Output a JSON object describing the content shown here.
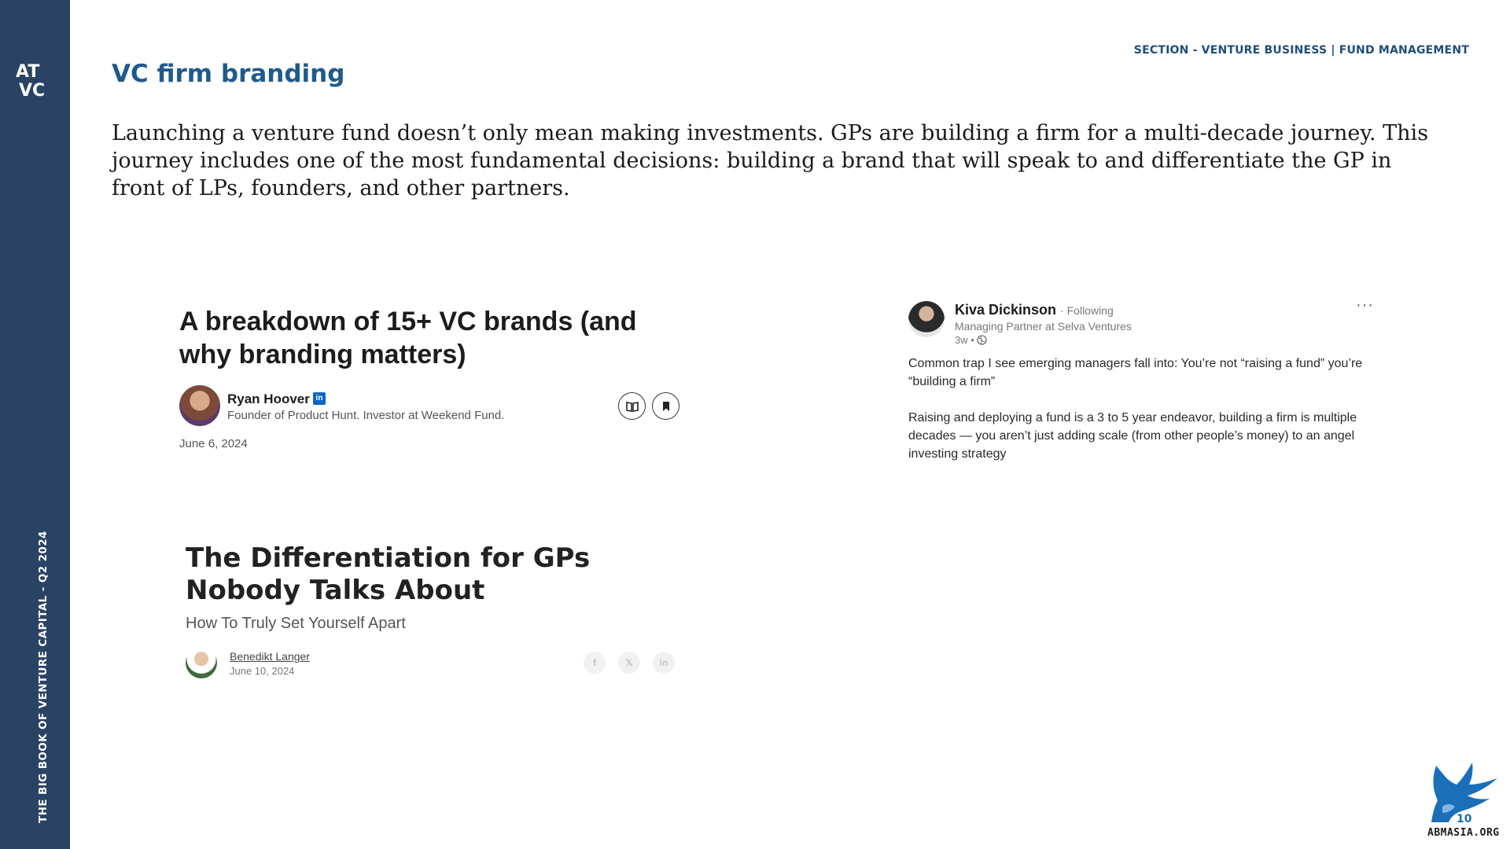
{
  "sidebar": {
    "logo_text": "ATVC",
    "vertical_title": "THE BIG BOOK OF VENTURE CAPITAL - Q2 2024"
  },
  "header": {
    "section_label": "SECTION - VENTURE BUSINESS | FUND MANAGEMENT",
    "title": "VC firm branding"
  },
  "intro": "Launching a venture fund doesn’t only mean making investments. GPs are building a firm for a multi-decade journey. This journey includes one of the most fundamental decisions: building a brand that will speak to and differentiate the GP in front of LPs, founders, and other partners.",
  "article1": {
    "headline": "A breakdown of 15+ VC brands (and why branding matters)",
    "author": "Ryan Hoover",
    "author_bio": "Founder of Product Hunt. Investor at Weekend Fund.",
    "date": "June 6, 2024",
    "badge_icon": "linkedin-icon",
    "actions": [
      "book-open-icon",
      "bookmark-icon"
    ]
  },
  "post": {
    "name": "Kiva Dickinson",
    "follow_status": "· Following",
    "role": "Managing Partner at Selva Ventures",
    "meta": "3w •",
    "paragraph1": "Common trap I see emerging managers fall into: You’re not “raising a fund” you’re “building a firm”",
    "paragraph2": "Raising and deploying a fund is a 3 to 5 year endeavor, building a firm is multiple decades — you aren’t just adding scale (from other people’s money) to an angel investing strategy",
    "more_label": "···"
  },
  "article2": {
    "headline": "The Differentiation for GPs Nobody Talks About",
    "subtitle": "How To Truly Set Yourself Apart",
    "author": "Benedikt Langer",
    "date": "June 10, 2024",
    "share_icons": [
      {
        "name": "facebook-icon",
        "glyph": "f"
      },
      {
        "name": "x-icon",
        "glyph": "𝕏"
      },
      {
        "name": "linkedin-icon",
        "glyph": "in"
      }
    ]
  },
  "watermark": {
    "caption": "ABMASIA.ORG",
    "number": "10"
  },
  "colors": {
    "sidebar": "#2a4365",
    "title": "#1f5a8c",
    "section_label": "#1f4e79",
    "linkedin": "#0a66c2"
  }
}
